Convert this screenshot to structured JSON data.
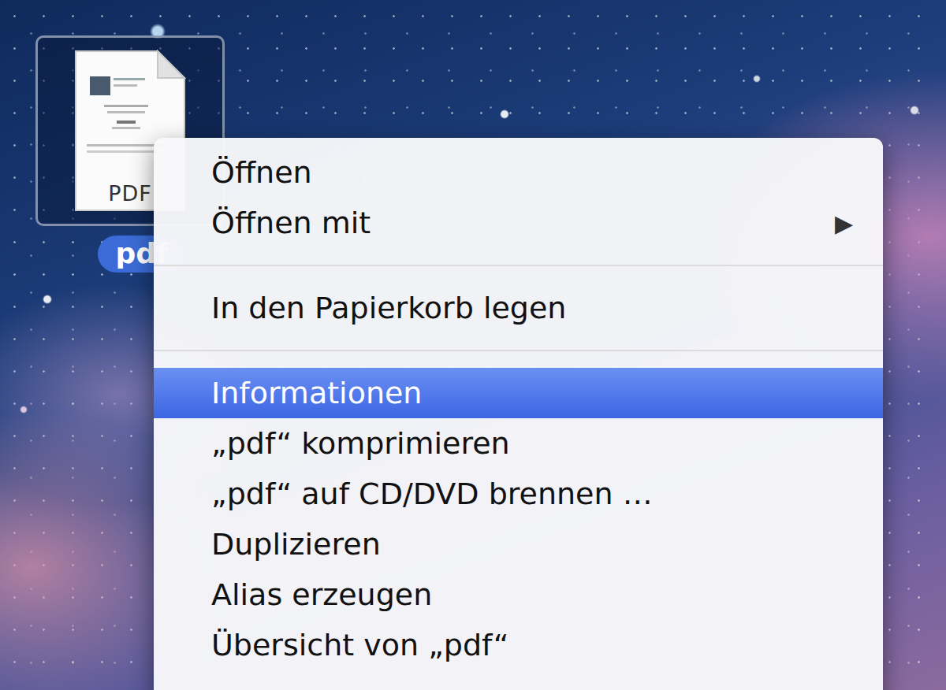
{
  "desktop": {
    "file": {
      "label": "pdf",
      "badge": "PDF",
      "selected": true
    }
  },
  "context_menu": {
    "submenu_glyph": "▶",
    "groups": [
      [
        {
          "label": "Öffnen",
          "selected": false,
          "kind": "plain"
        },
        {
          "label": "Öffnen mit",
          "selected": false,
          "kind": "submenu"
        }
      ],
      [
        {
          "label": "In den Papierkorb legen",
          "selected": false,
          "kind": "plain"
        }
      ],
      [
        {
          "label": "Informationen",
          "selected": true,
          "kind": "plain"
        },
        {
          "label": "„pdf“ komprimieren",
          "selected": false,
          "kind": "plain"
        },
        {
          "label": "„pdf“ auf CD/DVD brennen …",
          "selected": false,
          "kind": "plain"
        },
        {
          "label": "Duplizieren",
          "selected": false,
          "kind": "plain"
        },
        {
          "label": "Alias erzeugen",
          "selected": false,
          "kind": "plain"
        },
        {
          "label": "Übersicht von „pdf“",
          "selected": false,
          "kind": "plain"
        }
      ]
    ]
  }
}
